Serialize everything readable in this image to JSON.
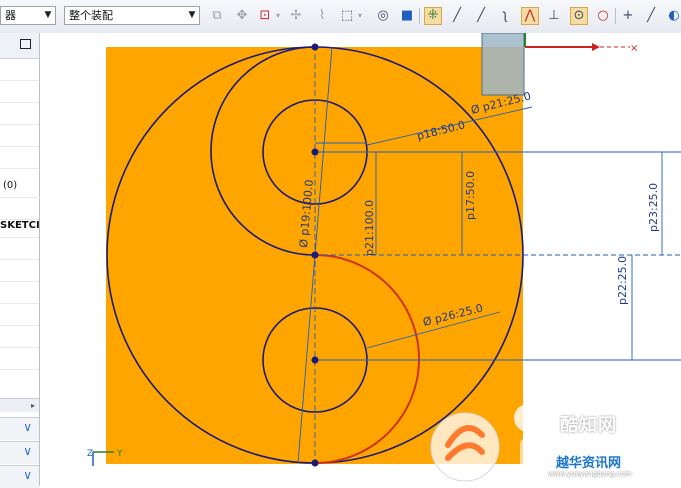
{
  "toolbar": {
    "selection_filter": {
      "value": "器"
    },
    "scope": {
      "value": "整个装配"
    },
    "icons": [
      "body-icon",
      "move-icon",
      "snap-icon",
      "pin-icon",
      "box-select-icon",
      "shaded-view-icon",
      "cube-icon",
      "snap-points-icon",
      "line-icon",
      "line-alt-icon",
      "curve-icon",
      "intersect-icon",
      "perpendicular-icon",
      "circle-center-icon",
      "circle-icon",
      "plus-icon",
      "slash-icon"
    ]
  },
  "navigator": {
    "rows": [
      {
        "label": ""
      },
      {
        "label": ""
      },
      {
        "label": ""
      },
      {
        "label": ""
      },
      {
        "label": ""
      },
      {
        "label": "(0)"
      },
      {
        "label": ""
      },
      {
        "label": "SKETCI"
      },
      {
        "label": ""
      },
      {
        "label": ""
      },
      {
        "label": ""
      },
      {
        "label": ""
      },
      {
        "label": ""
      },
      {
        "label": ""
      }
    ]
  },
  "sketch": {
    "fill_color": "#ffa500",
    "curve_color": "#1a1a7a",
    "arc_highlight_color": "#cc3322",
    "dimensions": {
      "p21": "Ø p21:25.0",
      "p18": "p18:50.0",
      "p17": "p17:50.0",
      "p23": "p23:25.0",
      "p19": "Ø p19:100.0",
      "p21_dist": "p21:100.0",
      "p22": "p22:25.0",
      "p26": "Ø p26:25.0"
    },
    "axis": {
      "x": "Y",
      "z": "Z"
    }
  },
  "watermark": {
    "brand": "酷知网",
    "sub": "越华资讯网",
    "url": "www.yueyangbang.com"
  }
}
